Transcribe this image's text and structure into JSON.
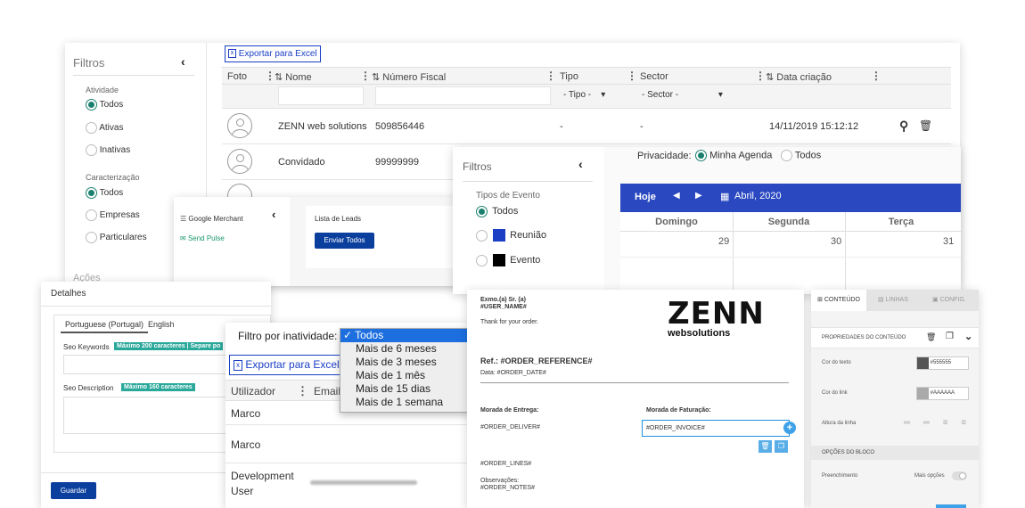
{
  "list_panel": {
    "filters_title": "Filtros",
    "activity_label": "Atividade",
    "activity_options": [
      "Todos",
      "Ativas",
      "Inativas"
    ],
    "char_label": "Caracterização",
    "char_options": [
      "Todos",
      "Empresas",
      "Particulares"
    ],
    "actions_label": "Ações",
    "export_label": "Exportar para Excel",
    "columns": [
      "Foto",
      "Nome",
      "Número Fiscal",
      "Tipo",
      "Sector",
      "Data criação"
    ],
    "tipo_filter": "- Tipo -",
    "sector_filter": "- Sector -",
    "rows": [
      {
        "name": "ZENN web solutions",
        "nif": "509856446",
        "tipo": "-",
        "sector": "-",
        "date": "14/11/2019 15:12:12"
      },
      {
        "name": "Convidado",
        "nif": "99999999",
        "tipo": "",
        "sector": "",
        "date": ""
      }
    ]
  },
  "leads_panel": {
    "menu": [
      "Google Merchant",
      "Send Pulse"
    ],
    "list_title": "Lista de Leads",
    "send_all": "Enviar Todos"
  },
  "calendar_panel": {
    "filters_title": "Filtros",
    "event_types_label": "Tipos de Evento",
    "event_options": [
      "Todos",
      "Reunião",
      "Evento"
    ],
    "privacy_label": "Privacidade:",
    "privacy_options": [
      "Minha Agenda",
      "Todos"
    ],
    "today": "Hoje",
    "month": "Abril, 2020",
    "days": [
      "Domingo",
      "Segunda",
      "Terça"
    ],
    "dates": [
      "29",
      "30",
      "31"
    ],
    "colors": {
      "reuniao": "#1a3fc4",
      "evento": "#000000",
      "header": "#2a48c0"
    }
  },
  "details_panel": {
    "title": "Detalhes",
    "tabs": [
      "Portuguese (Portugal)",
      "English"
    ],
    "seo_keywords": "Seo Keywords",
    "seo_keywords_badge": "Máximo 200 caracteres | Separe po",
    "seo_description": "Seo Description",
    "seo_description_badge": "Máximo 160 caracteres",
    "save": "Guardar"
  },
  "inactivity_panel": {
    "filter_label": "Filtro por inatividade:",
    "export_label": "Exportar para Excel",
    "columns": [
      "Utilizador",
      "Email"
    ],
    "options": [
      "Todos",
      "Mais de 6 meses",
      "Mais de 3 meses",
      "Mais de 1 mês",
      "Mais de 15 dias",
      "Mais de 1 semana"
    ],
    "rows": [
      "Marco",
      "Marco",
      "Development User"
    ]
  },
  "email_panel": {
    "greeting": "Exmo.(a) Sr. (a)",
    "user_name": "#USER_NAME#",
    "thanks": "Thank for your order.",
    "ref": "Ref.: #ORDER_REFERENCE#",
    "date": "Data: #ORDER_DATE#",
    "delivery_label": "Morada de Entrega:",
    "invoice_label": "Morada de Faturação:",
    "delivery": "#ORDER_DELIVER#",
    "invoice": "#ORDER_INVOICE#",
    "lines": "#ORDER_LINES#",
    "notes_label": "Observações:",
    "notes": "#ORDER_NOTES#",
    "logo_main": "ZENN",
    "logo_sub": "websolutions"
  },
  "editor_panel": {
    "tabs": [
      "CONTEÚDO",
      "LINHAS",
      "CONFIG."
    ],
    "section_title": "PROPRIEDADES DO CONTEÚDO",
    "text_color_label": "Cor do texto",
    "text_color": "#555555",
    "link_color_label": "Cor do link",
    "link_color": "#AAAAAA",
    "line_height_label": "Altura da linha",
    "block_options": "OPÇÕES DO BLOCO",
    "fill_label": "Preenchimento",
    "more_options": "Mais opções"
  }
}
